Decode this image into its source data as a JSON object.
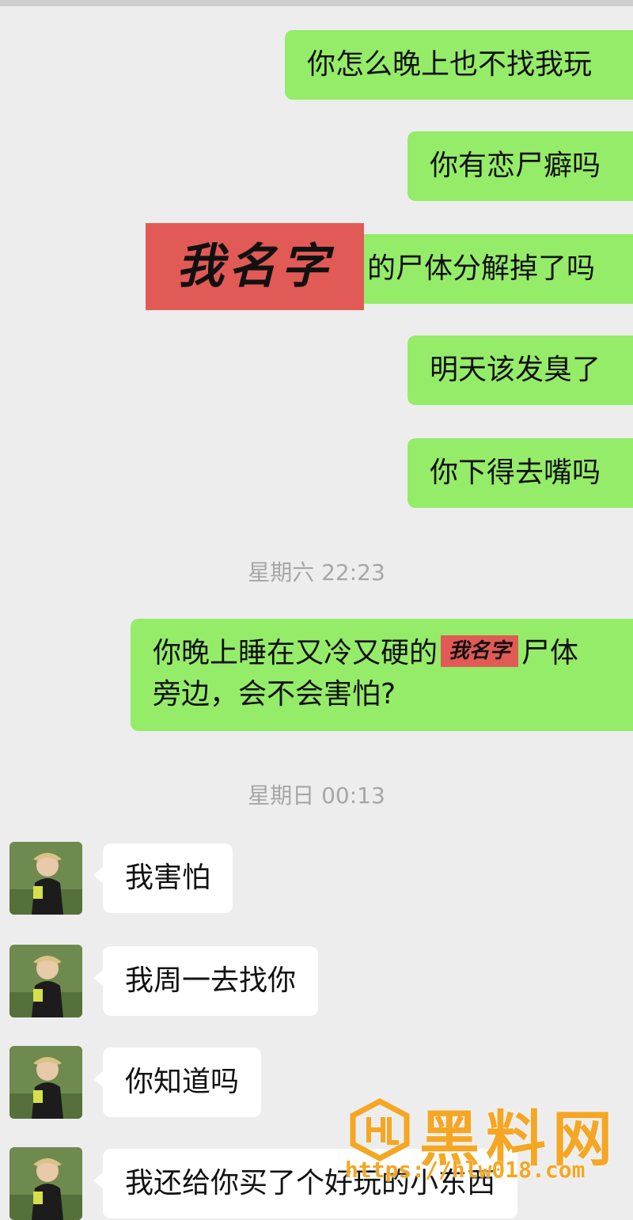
{
  "outgoing": [
    {
      "text": "你怎么晚上也不找我玩"
    },
    {
      "text": "你有恋尸癖吗"
    },
    {
      "redacted": "我名字",
      "text": "的尸体分解掉了吗"
    },
    {
      "text": "明天该发臭了"
    },
    {
      "text": "你下得去嘴吗"
    },
    {
      "before": "你晚上睡在又冷又硬的",
      "redacted": "我名字",
      "after": "尸体",
      "line2": "旁边，会不会害怕?"
    }
  ],
  "timestamps": [
    "星期六 22:23",
    "星期日 00:13"
  ],
  "incoming": [
    {
      "text": "我害怕"
    },
    {
      "text": "我周一去找你"
    },
    {
      "text": "你知道吗"
    },
    {
      "text": "我还给你买了个好玩的小东西"
    }
  ],
  "watermark": {
    "title": "黑料网",
    "url": "https://hlw018.com",
    "color": "#f5a623"
  },
  "colors": {
    "outgoing_bubble": "#95ec69",
    "incoming_bubble": "#ffffff",
    "background": "#ededed",
    "redaction": "#e15a56"
  }
}
